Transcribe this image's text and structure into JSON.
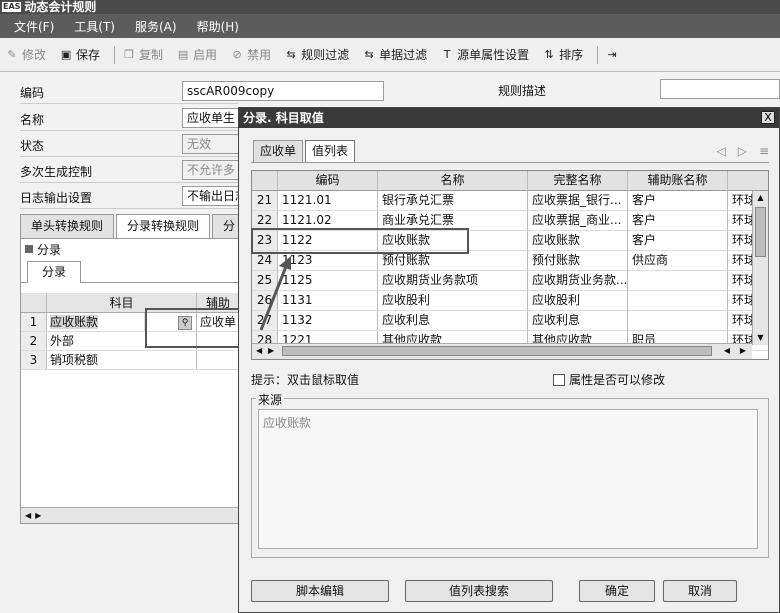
{
  "window": {
    "logo": "EAS",
    "title": "动态会计规则"
  },
  "menu": [
    "文件(F)",
    "工具(T)",
    "服务(A)",
    "帮助(H)"
  ],
  "toolbar": [
    {
      "label": "修改",
      "icon": "pencil-icon",
      "enabled": false
    },
    {
      "label": "保存",
      "icon": "save-icon",
      "enabled": true
    },
    {
      "label": "复制",
      "icon": "copy-icon",
      "enabled": false
    },
    {
      "label": "启用",
      "icon": "enable-icon",
      "enabled": false
    },
    {
      "label": "禁用",
      "icon": "disable-icon",
      "enabled": false
    },
    {
      "label": "规则过滤",
      "icon": "filter-icon",
      "enabled": true
    },
    {
      "label": "单据过滤",
      "icon": "filter-icon",
      "enabled": true
    },
    {
      "label": "源单属性设置",
      "icon": "text-icon",
      "enabled": true
    },
    {
      "label": "排序",
      "icon": "sort-icon",
      "enabled": true
    },
    {
      "label": "",
      "icon": "exit-icon",
      "enabled": true
    }
  ],
  "form": {
    "code_label": "编码",
    "code_value": "sscAR009copy",
    "desc_label": "规则描述",
    "desc_value": "",
    "name_label": "名称",
    "name_value": "应收单生",
    "status_label": "状态",
    "status_value": "无效",
    "multi_label": "多次生成控制",
    "multi_value": "不允许多",
    "log_label": "日志输出设置",
    "log_value": "不输出日志"
  },
  "left_tabs": [
    "单头转换规则",
    "分录转换规则",
    "分"
  ],
  "entry": {
    "section_label": "分录",
    "subtab": "分录",
    "columns": [
      "科目",
      "辅助"
    ],
    "rows": [
      {
        "num": "1",
        "subject": "应收账款",
        "aux": "应收单"
      },
      {
        "num": "2",
        "subject": "外部",
        "aux": ""
      },
      {
        "num": "3",
        "subject": "销项税额",
        "aux": ""
      }
    ]
  },
  "dialog": {
    "title": "分录. 科目取值",
    "close": "X",
    "tabs": [
      "应收单",
      "值列表"
    ],
    "columns": [
      "编码",
      "名称",
      "完整名称",
      "辅助账名称",
      ""
    ],
    "rows": [
      {
        "num": "21",
        "code": "1121.01",
        "name": "银行承兑汇票",
        "full": "应收票据_银行...",
        "aux": "客户",
        "extra": "环球"
      },
      {
        "num": "22",
        "code": "1121.02",
        "name": "商业承兑汇票",
        "full": "应收票据_商业...",
        "aux": "客户",
        "extra": "环球"
      },
      {
        "num": "23",
        "code": "1122",
        "name": "应收账款",
        "full": "应收账款",
        "aux": "客户",
        "extra": "环球"
      },
      {
        "num": "24",
        "code": "1123",
        "name": "预付账款",
        "full": "预付账款",
        "aux": "供应商",
        "extra": "环球"
      },
      {
        "num": "25",
        "code": "1125",
        "name": "应收期货业务款项",
        "full": "应收期货业务款...",
        "aux": "",
        "extra": "环球"
      },
      {
        "num": "26",
        "code": "1131",
        "name": "应收股利",
        "full": "应收股利",
        "aux": "",
        "extra": "环球"
      },
      {
        "num": "27",
        "code": "1132",
        "name": "应收利息",
        "full": "应收利息",
        "aux": "",
        "extra": "环球"
      },
      {
        "num": "28",
        "code": "1221",
        "name": "其他应收款",
        "full": "其他应收款",
        "aux": "职员",
        "extra": "环球"
      }
    ],
    "hint": "提示：双击鼠标取值",
    "attr_checkbox": "属性是否可以修改",
    "source_label": "来源",
    "source_value": "应收账款",
    "buttons": {
      "script": "脚本编辑",
      "search": "值列表搜索",
      "ok": "确定",
      "cancel": "取消"
    }
  }
}
